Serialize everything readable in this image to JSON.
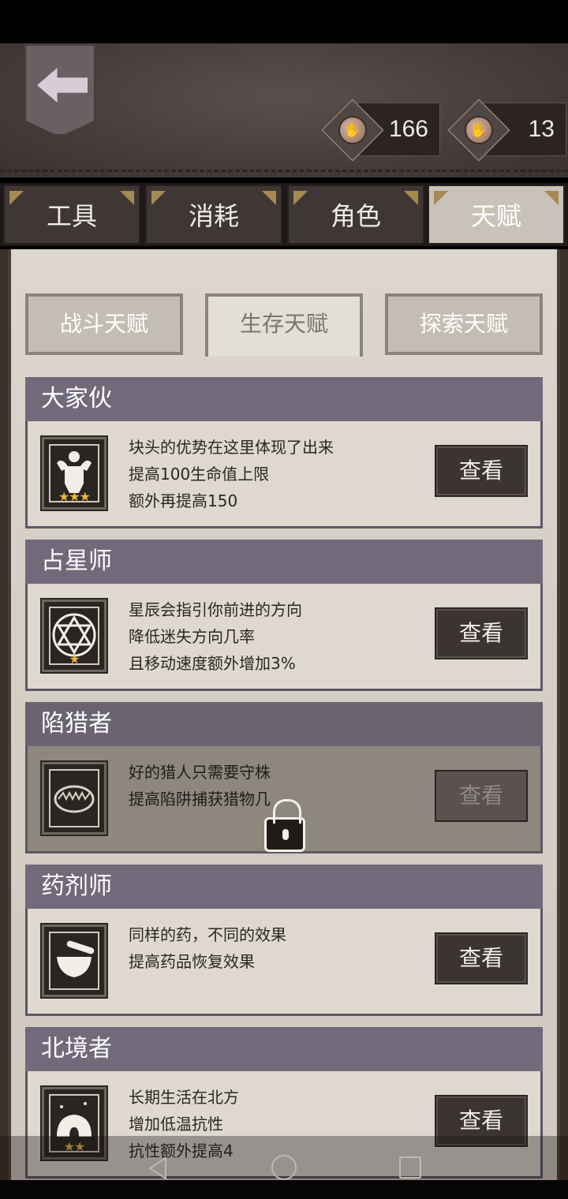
{
  "currencies": [
    {
      "icon": "coin-icon",
      "value": "166"
    },
    {
      "icon": "coin-icon",
      "value": "13"
    }
  ],
  "tabs": [
    {
      "label": "工具",
      "active": false
    },
    {
      "label": "消耗",
      "active": false
    },
    {
      "label": "角色",
      "active": false
    },
    {
      "label": "天赋",
      "active": true
    }
  ],
  "subtabs": [
    {
      "label": "战斗天赋",
      "active": false
    },
    {
      "label": "生存天赋",
      "active": true
    },
    {
      "label": "探索天赋",
      "active": false
    }
  ],
  "talents": [
    {
      "name": "大家伙",
      "icon": "muscle-man-icon",
      "stars": "★★★",
      "locked": false,
      "lines": [
        "块头的优势在这里体现了出来",
        "提高100生命值上限",
        "额外再提高150"
      ],
      "button": "查看"
    },
    {
      "name": "占星师",
      "icon": "hexagram-icon",
      "stars": "★",
      "locked": false,
      "lines": [
        "星辰会指引你前进的方向",
        "降低迷失方向几率",
        "且移动速度额外增加3%"
      ],
      "button": "查看"
    },
    {
      "name": "陷猎者",
      "icon": "bear-trap-icon",
      "stars": "",
      "locked": true,
      "lines": [
        "好的猎人只需要守株",
        "提高陷阱捕获猎物几"
      ],
      "button": "查看"
    },
    {
      "name": "药剂师",
      "icon": "mortar-pestle-icon",
      "stars": "",
      "locked": false,
      "lines": [
        "同样的药，不同的效果",
        "提高药品恢复效果"
      ],
      "button": "查看"
    },
    {
      "name": "北境者",
      "icon": "igloo-icon",
      "stars": "★★",
      "locked": false,
      "lines": [
        "长期生活在北方",
        "增加低温抗性",
        "抗性额外提高4"
      ],
      "button": "查看"
    }
  ],
  "colors": {
    "accent_gold": "#e7b83a",
    "header_purple": "#716a7b",
    "parchment": "#dcd6cd"
  }
}
